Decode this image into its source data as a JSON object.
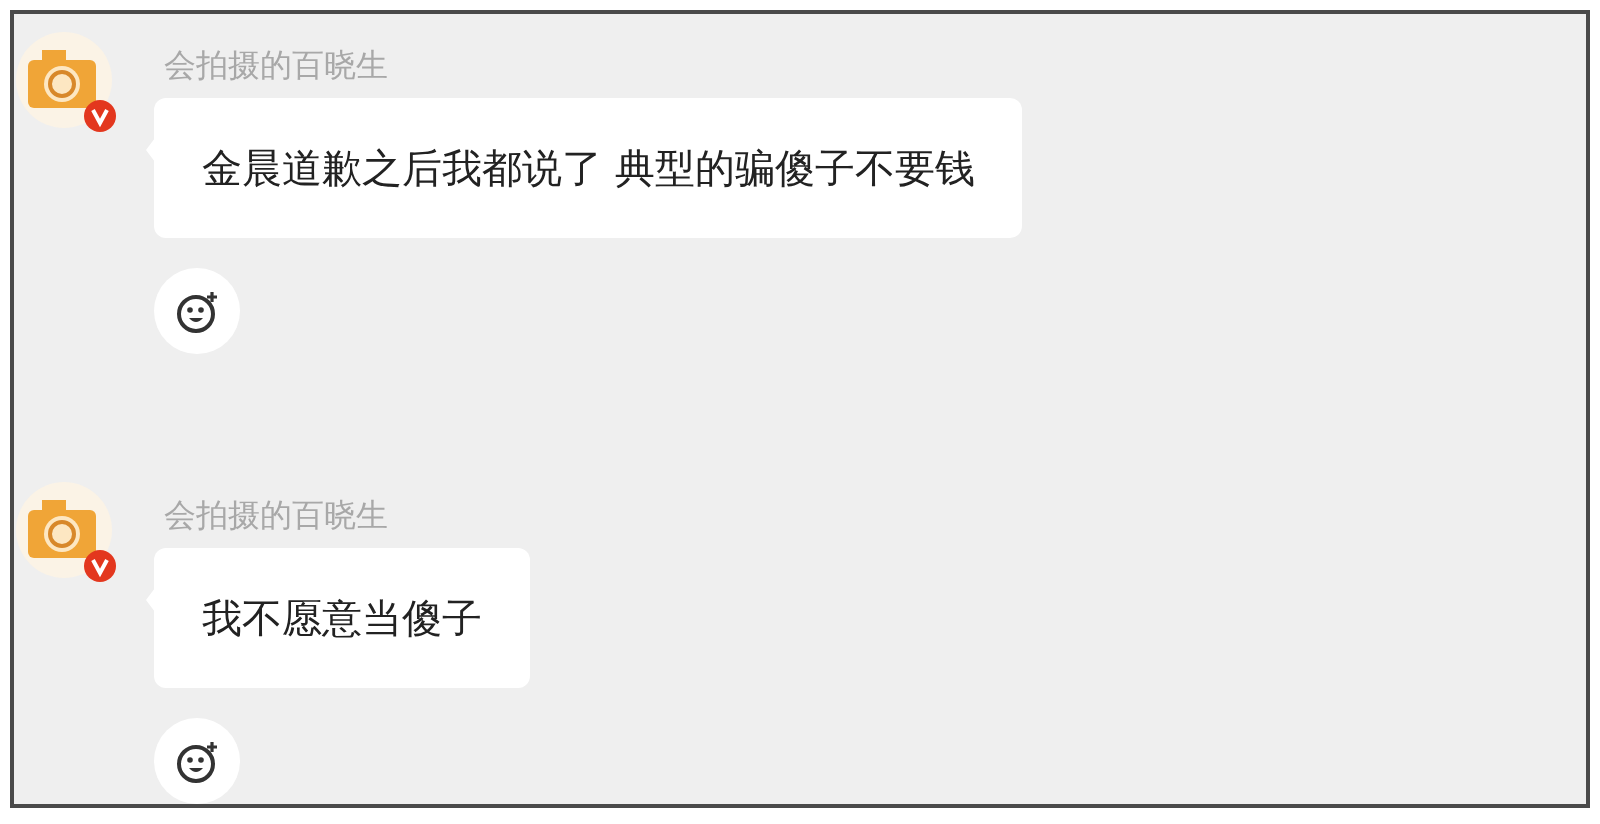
{
  "messages": [
    {
      "sender": "会拍摄的百晓生",
      "verified": true,
      "text": "金晨道歉之后我都说了 典型的骗傻子不要钱"
    },
    {
      "sender": "会拍摄的百晓生",
      "verified": true,
      "text": "我不愿意当傻子"
    }
  ]
}
